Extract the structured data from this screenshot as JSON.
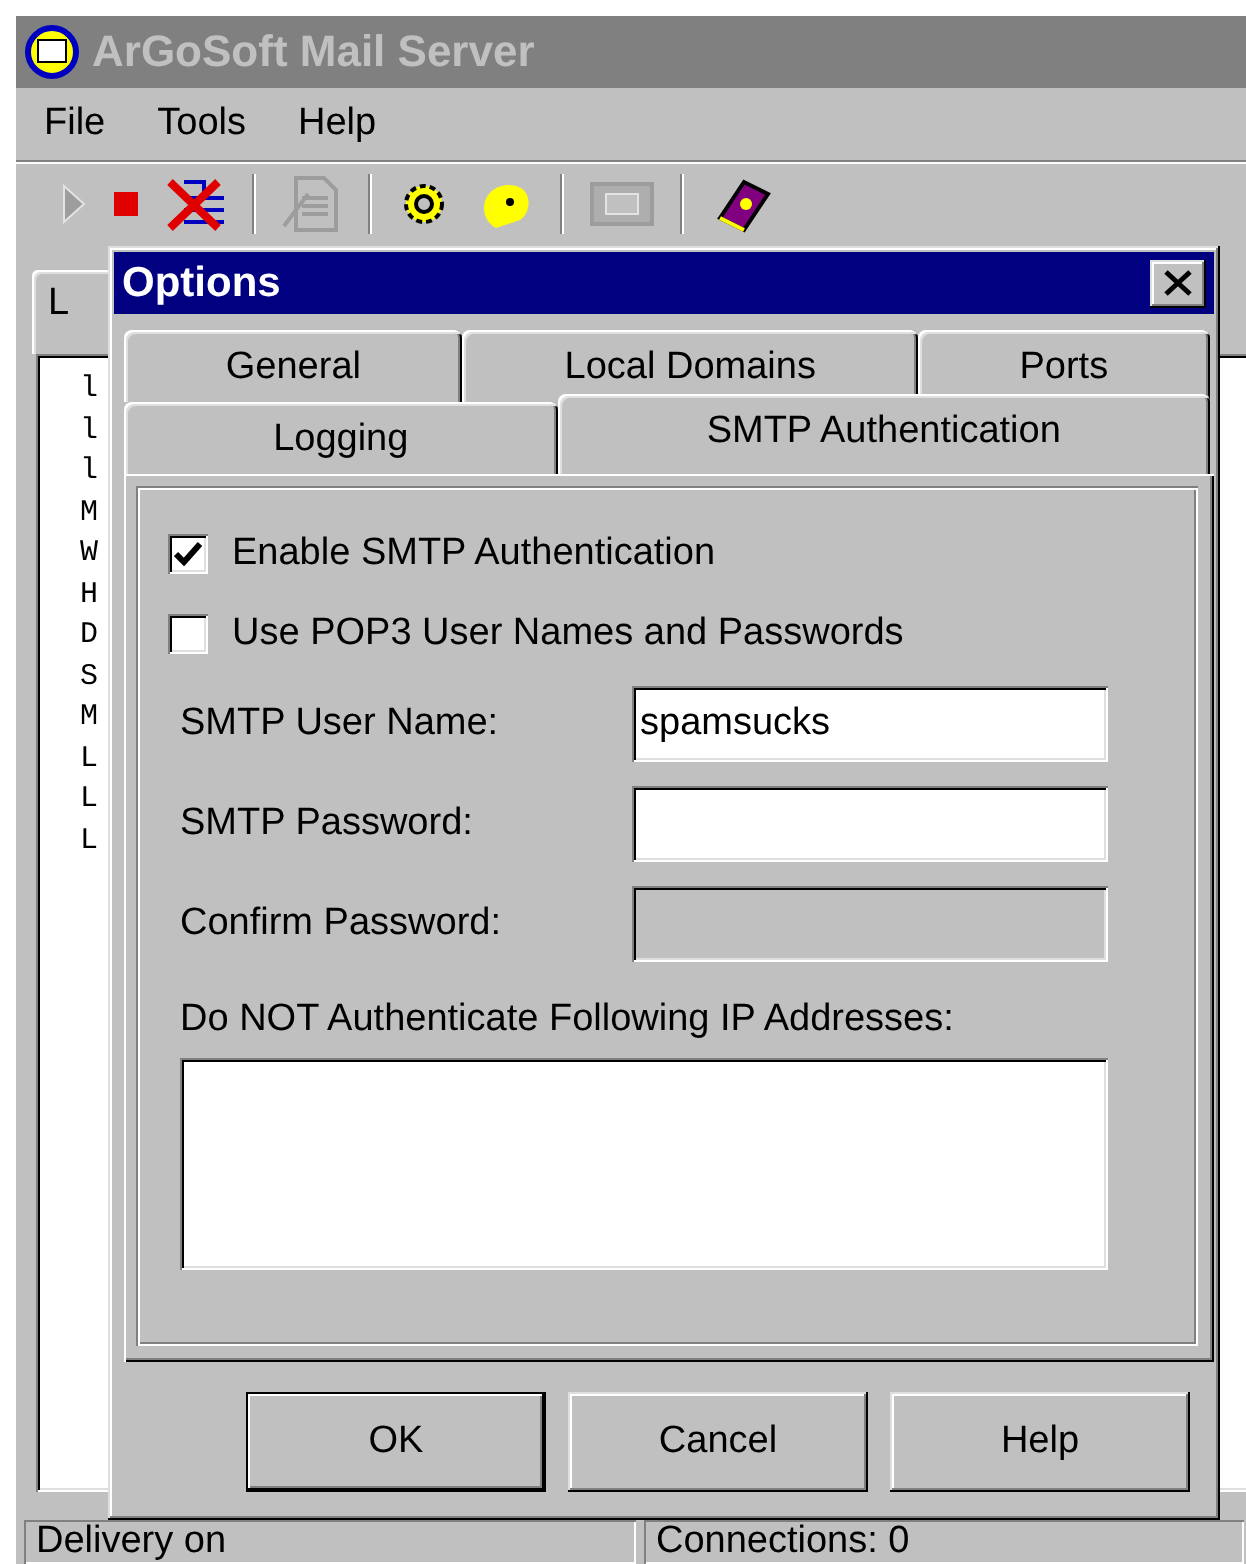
{
  "main_window": {
    "title": "ArGoSoft Mail Server",
    "menu": [
      "File",
      "Tools",
      "Help"
    ],
    "toolbar": [
      {
        "kind": "play",
        "disabled": true
      },
      {
        "kind": "stop",
        "disabled": false
      },
      {
        "kind": "delete",
        "disabled": false
      },
      {
        "kind": "separator"
      },
      {
        "kind": "document",
        "disabled": true
      },
      {
        "kind": "separator"
      },
      {
        "kind": "gear",
        "disabled": false
      },
      {
        "kind": "blob",
        "disabled": false
      },
      {
        "kind": "separator"
      },
      {
        "kind": "mailbox",
        "disabled": true
      },
      {
        "kind": "separator"
      },
      {
        "kind": "book",
        "disabled": false
      }
    ],
    "background_tab": {
      "label": "L"
    },
    "log_lines": [
      {
        "start": "l"
      },
      {
        "start": "l"
      },
      {
        "start": "l"
      },
      {
        "start": "M"
      },
      {
        "start": "W"
      },
      {
        "start": "H"
      },
      {
        "start": "D"
      },
      {
        "start": "S"
      },
      {
        "start": "M"
      },
      {
        "start": "L"
      },
      {
        "start": "L"
      },
      {
        "start": "L"
      }
    ],
    "status_bar": [
      "Delivery on",
      "Connections: 0"
    ]
  },
  "dialog": {
    "title": "Options",
    "tab_rows": [
      [
        {
          "label": "General",
          "selected": false
        },
        {
          "label": "Local Domains",
          "selected": false
        },
        {
          "label": "Ports",
          "selected": false
        }
      ],
      [
        {
          "label": "Logging",
          "selected": false
        },
        {
          "label": "SMTP Authentication",
          "selected": true
        }
      ]
    ],
    "checkboxes": [
      {
        "label": "Enable SMTP Authentication",
        "checked": true
      },
      {
        "label": "Use POP3 User Names and Passwords",
        "checked": false
      }
    ],
    "fields": [
      {
        "label": "SMTP User Name:",
        "value": "spamsucks",
        "disabled": false
      },
      {
        "label": "SMTP Password:",
        "disabled": false
      },
      {
        "label": "Confirm Password:",
        "disabled": true
      }
    ],
    "ip_list": {
      "label": "Do NOT Authenticate Following IP Addresses:"
    },
    "buttons": [
      {
        "label": "OK",
        "default": true
      },
      {
        "label": "Cancel",
        "default": false
      },
      {
        "label": "Help",
        "default": false
      }
    ]
  }
}
